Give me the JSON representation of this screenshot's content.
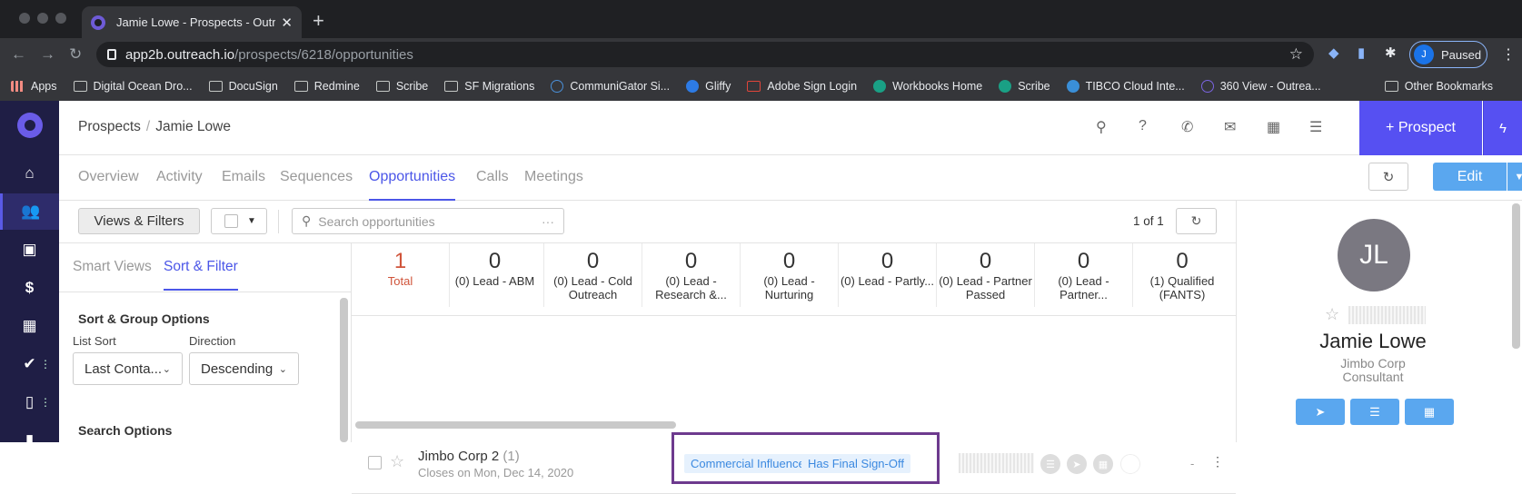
{
  "browser": {
    "tab_title": "Jamie Lowe - Prospects - Outr",
    "tab_close": "✕",
    "new_tab": "+",
    "url_host": "app2b.outreach.io",
    "url_path": "/prospects/6218/opportunities",
    "profile_initial": "J",
    "profile_status": "Paused",
    "bookmarks": [
      "Apps",
      "Digital Ocean Dro...",
      "DocuSign",
      "Redmine",
      "Scribe",
      "SF Migrations",
      "CommuniGator Si...",
      "Gliffy",
      "Adobe Sign Login",
      "Workbooks Home",
      "Scribe",
      "TIBCO Cloud Inte...",
      "360 View - Outrea..."
    ],
    "other_bookmarks": "Other Bookmarks"
  },
  "header": {
    "breadcrumb_root": "Prospects",
    "breadcrumb_sep": "/",
    "breadcrumb_current": "Jamie Lowe",
    "prospect_button": "+ Prospect"
  },
  "tabs": [
    "Overview",
    "Activity",
    "Emails",
    "Sequences",
    "Opportunities",
    "Calls",
    "Meetings"
  ],
  "edit_label": "Edit",
  "toolbar": {
    "views_filters": "Views & Filters",
    "search_placeholder": "Search opportunities",
    "pager": "1 of 1"
  },
  "left_panel": {
    "tab_smart": "Smart Views",
    "tab_sort": "Sort & Filter",
    "section_title": "Sort & Group Options",
    "list_sort_label": "List Sort",
    "list_sort_value": "Last Conta...",
    "direction_label": "Direction",
    "direction_value": "Descending",
    "search_options": "Search Options"
  },
  "stats": [
    {
      "count": "1",
      "label": "Total"
    },
    {
      "count": "0",
      "label": "(0) Lead - ABM"
    },
    {
      "count": "0",
      "label": "(0) Lead - Cold Outreach"
    },
    {
      "count": "0",
      "label": "(0) Lead - Research &..."
    },
    {
      "count": "0",
      "label": "(0) Lead - Nurturing"
    },
    {
      "count": "0",
      "label": "(0) Lead - Partly..."
    },
    {
      "count": "0",
      "label": "(0) Lead - Partner Passed"
    },
    {
      "count": "0",
      "label": "(0) Lead - Partner..."
    },
    {
      "count": "0",
      "label": "(1) Qualified (FANTS)"
    }
  ],
  "opportunity": {
    "name": "Jimbo Corp 2",
    "count": "(1)",
    "closes": "Closes on Mon, Dec 14, 2020",
    "tags": [
      "Commercial Influencer",
      "Has Final Sign-Off"
    ],
    "amount": "-"
  },
  "profile": {
    "initials": "JL",
    "name": "Jamie Lowe",
    "company": "Jimbo Corp",
    "title": "Consultant"
  }
}
